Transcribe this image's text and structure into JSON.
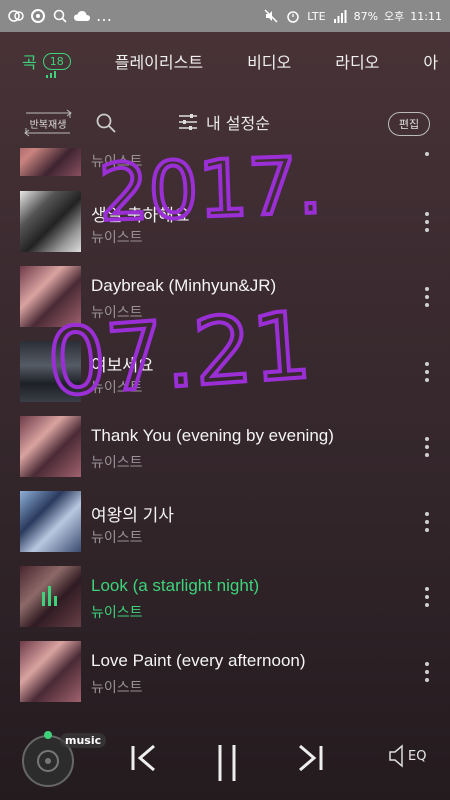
{
  "status_bar": {
    "battery": "87%",
    "ampm": "오후",
    "time": "11:11",
    "network": "LTE"
  },
  "tabs": [
    {
      "label": "곡",
      "badge": "18",
      "active": true
    },
    {
      "label": "플레이리스트"
    },
    {
      "label": "비디오"
    },
    {
      "label": "라디오"
    },
    {
      "label": "아"
    }
  ],
  "toolbar": {
    "repeat_label": "반복재생",
    "sort_label": "내 설정순",
    "edit_label": "편집"
  },
  "songs": [
    {
      "title": "",
      "artist": "뉴이스트"
    },
    {
      "title": "생일 축하해요",
      "artist": "뉴이스트"
    },
    {
      "title": "Daybreak (Minhyun&JR)",
      "artist": "뉴이스트"
    },
    {
      "title": "여보세요",
      "artist": "뉴이스트"
    },
    {
      "title": "Thank You (evening by evening)",
      "artist": "뉴이스트"
    },
    {
      "title": "여왕의 기사",
      "artist": "뉴이스트"
    },
    {
      "title": "Look (a starlight night)",
      "artist": "뉴이스트",
      "playing": true
    },
    {
      "title": "Love Paint (every afternoon)",
      "artist": "뉴이스트"
    }
  ],
  "handwriting": {
    "line1": "2017.",
    "line2": "07.21",
    "color": "#9b2fd6"
  },
  "player": {
    "music_label": "music",
    "eq_label": "EQ"
  },
  "colors": {
    "accent": "#3ed37a"
  }
}
